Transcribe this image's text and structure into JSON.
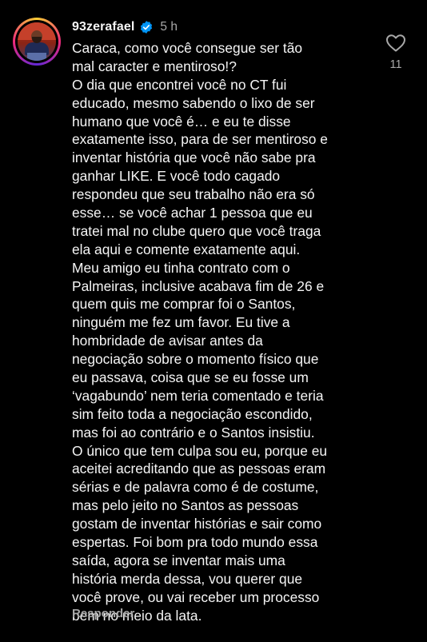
{
  "comment": {
    "username": "93zerafael",
    "timestamp": "5 h",
    "verified": true,
    "lines": [
      "Caraca, como você consegue ser tão",
      "mal caracter e mentiroso!?",
      "O dia que encontrei você no CT fui",
      "educado, mesmo sabendo o lixo de ser",
      "humano que você é… e eu te disse",
      "exatamente isso, para de ser mentiroso e",
      "inventar história que você não sabe pra",
      "ganhar LIKE. E você todo cagado",
      "respondeu que seu trabalho não era só",
      "esse… se você achar 1 pessoa que eu",
      "tratei mal no clube quero que você traga",
      "ela aqui e comente exatamente aqui.",
      "Meu amigo eu tinha contrato com o",
      "Palmeiras, inclusive acabava fim de 26 e",
      "quem quis me comprar foi o Santos,",
      "ninguém me fez um favor. Eu tive a",
      "hombridade de avisar antes da",
      "negociação sobre o momento físico que",
      "eu passava, coisa que se eu fosse um",
      "‘vagabundo’ nem teria comentado e teria",
      "sim feito toda a negociação escondido,",
      "mas foi ao contrário e o Santos insistiu.",
      "O único que tem culpa sou eu, porque eu",
      "aceitei acreditando que as pessoas eram",
      "sérias e de palavra como é de costume,",
      "mas pelo jeito no Santos as pessoas",
      "gostam de inventar histórias e sair como",
      "espertas. Foi bom pra todo mundo essa",
      "saída, agora se inventar mais uma",
      "história merda dessa, vou querer que",
      "você prove, ou vai receber um processo",
      "bem no meio da lata."
    ],
    "reply_label": "Responder",
    "like_count": "11"
  },
  "icons": {
    "like": "heart-outline-icon",
    "verified": "verified-badge-icon"
  },
  "colors": {
    "background": "#000000",
    "text": "#f5f5f5",
    "secondary_text": "#a8a8a8",
    "verified_blue": "#0095f6"
  }
}
